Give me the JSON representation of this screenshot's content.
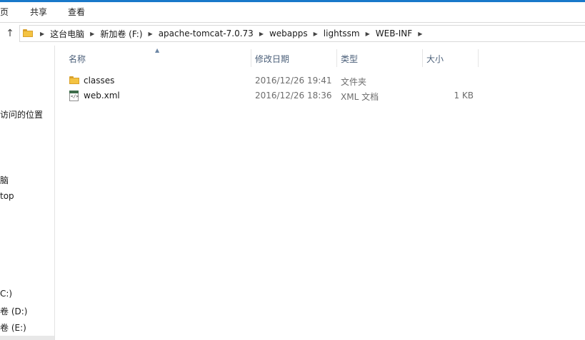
{
  "ribbon": {
    "tabs": [
      "页",
      "共享",
      "查看"
    ]
  },
  "address": {
    "crumbs": [
      "这台电脑",
      "新加卷 (F:)",
      "apache-tomcat-7.0.73",
      "webapps",
      "lightssm",
      "WEB-INF"
    ]
  },
  "navpane": {
    "items": [
      "访问的位置",
      "脑",
      "top",
      "C:)",
      "卷 (D:)",
      "卷 (E:)"
    ]
  },
  "columns": {
    "name": "名称",
    "date": "修改日期",
    "type": "类型",
    "size": "大小"
  },
  "files": [
    {
      "icon": "folder-icon",
      "name": "classes",
      "date": "2016/12/26 19:41",
      "type": "文件夹",
      "size": ""
    },
    {
      "icon": "xml-file-icon",
      "name": "web.xml",
      "date": "2016/12/26 18:36",
      "type": "XML 文档",
      "size": "1 KB"
    }
  ],
  "colors": {
    "accent": "#1979ca",
    "header_text": "#4c607a",
    "folder": "#f4c342"
  }
}
